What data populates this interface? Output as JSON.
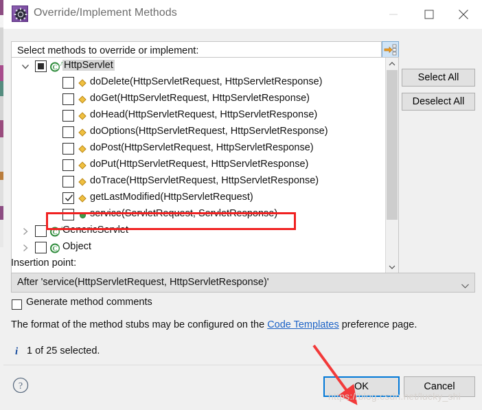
{
  "window": {
    "title": "Override/Implement Methods",
    "icon": "gear-icon",
    "minimize_label": "Minimize",
    "maximize_label": "Maximize",
    "close_label": "Close"
  },
  "group": {
    "label": "Select methods to override or implement:",
    "toolbar_icon": "show-hierarchy-icon"
  },
  "side_buttons": {
    "select_all": "Select All",
    "deselect_all": "Deselect All"
  },
  "tree": {
    "rows": [
      {
        "label": "HttpServlet",
        "indent": 0,
        "check": "partial",
        "icon": "abstract-class-icon",
        "expanded": true,
        "selected": true
      },
      {
        "label": "doDelete(HttpServletRequest, HttpServletResponse)",
        "indent": 1,
        "check": "unchecked",
        "icon": "protected-method-icon"
      },
      {
        "label": "doGet(HttpServletRequest, HttpServletResponse)",
        "indent": 1,
        "check": "unchecked",
        "icon": "protected-method-icon"
      },
      {
        "label": "doHead(HttpServletRequest, HttpServletResponse)",
        "indent": 1,
        "check": "unchecked",
        "icon": "protected-method-icon"
      },
      {
        "label": "doOptions(HttpServletRequest, HttpServletResponse)",
        "indent": 1,
        "check": "unchecked",
        "icon": "protected-method-icon"
      },
      {
        "label": "doPost(HttpServletRequest, HttpServletResponse)",
        "indent": 1,
        "check": "unchecked",
        "icon": "protected-method-icon"
      },
      {
        "label": "doPut(HttpServletRequest, HttpServletResponse)",
        "indent": 1,
        "check": "unchecked",
        "icon": "protected-method-icon"
      },
      {
        "label": "doTrace(HttpServletRequest, HttpServletResponse)",
        "indent": 1,
        "check": "unchecked",
        "icon": "protected-method-icon"
      },
      {
        "label": "getLastModified(HttpServletRequest)",
        "indent": 1,
        "check": "checked",
        "icon": "protected-method-icon",
        "highlighted": true
      },
      {
        "label": "service(ServletRequest, ServletResponse)",
        "indent": 1,
        "check": "unchecked",
        "icon": "public-method-icon"
      },
      {
        "label": "GenericServlet",
        "indent": 0,
        "check": "unchecked",
        "icon": "abstract-class-icon",
        "expanded": false
      },
      {
        "label": "Object",
        "indent": 0,
        "check": "unchecked",
        "icon": "class-icon",
        "expanded": false
      }
    ]
  },
  "insertion": {
    "label": "Insertion point:",
    "value": "After 'service(HttpServletRequest, HttpServletResponse)'"
  },
  "options": {
    "generate_comments_label": "Generate method comments",
    "generate_comments_checked": false
  },
  "format_note": {
    "before": "The format of the method stubs may be configured on the ",
    "link": "Code Templates",
    "after": " preference page."
  },
  "status": {
    "icon": "info-icon",
    "text": "1 of 25 selected."
  },
  "footer": {
    "help_icon": "help-icon",
    "ok": "OK",
    "cancel": "Cancel"
  },
  "watermark": "https://blog.csdn.net/lucky_shi",
  "colors": {
    "accent": "#0078d7",
    "annotation": "#f02020",
    "link": "#1a61c6",
    "dialog_bg": "#f0f0f0",
    "method_icon": "#f0c040",
    "class_icon": "#3f9c4a"
  }
}
